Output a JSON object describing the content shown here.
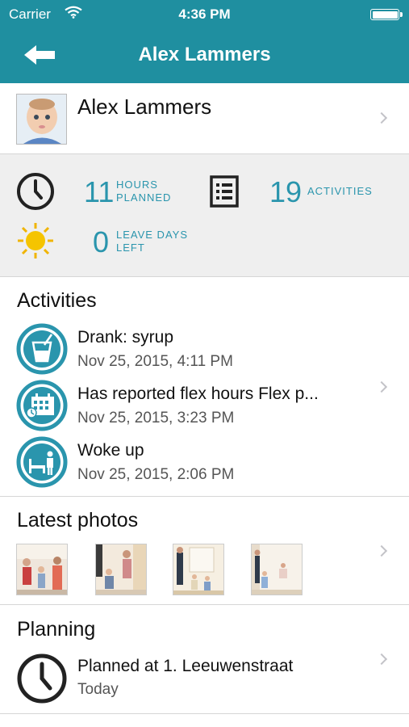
{
  "status_bar": {
    "carrier": "Carrier",
    "time": "4:36 PM"
  },
  "nav": {
    "title": "Alex Lammers",
    "back_icon": "arrow-left-icon"
  },
  "profile": {
    "name": "Alex Lammers"
  },
  "stats": {
    "hours": {
      "value": "11",
      "label_line1": "HOURS",
      "label_line2": "PLANNED"
    },
    "activities": {
      "value": "19",
      "label": "ACTIVITIES"
    },
    "leave": {
      "value": "0",
      "label_line1": "LEAVE DAYS",
      "label_line2": "LEFT"
    }
  },
  "activities": {
    "title": "Activities",
    "items": [
      {
        "icon": "drink-icon",
        "title": "Drank: syrup",
        "date": "Nov 25, 2015, 4:11 PM"
      },
      {
        "icon": "flex-hours-icon",
        "title": "Has reported flex hours Flex p...",
        "date": "Nov 25, 2015, 3:23 PM"
      },
      {
        "icon": "woke-up-icon",
        "title": "Woke up",
        "date": "Nov 25, 2015, 2:06 PM"
      }
    ]
  },
  "photos": {
    "title": "Latest photos",
    "count": 4
  },
  "planning": {
    "title": "Planning",
    "item_title": "Planned at 1. Leeuwenstraat",
    "item_date": "Today"
  },
  "colors": {
    "header": "#1f8fa0",
    "accent": "#2a95ad",
    "stats_bg": "#efefef"
  }
}
